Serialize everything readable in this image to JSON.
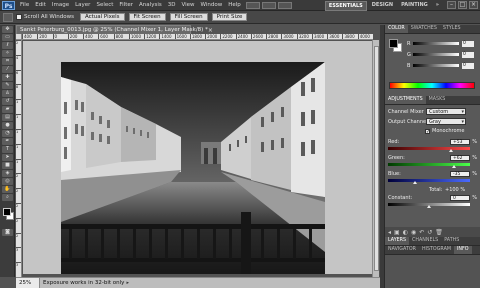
{
  "menubar": {
    "logo": "Ps",
    "items": [
      "File",
      "Edit",
      "Image",
      "Layer",
      "Select",
      "Filter",
      "Analysis",
      "3D",
      "View",
      "Window",
      "Help"
    ],
    "workspaces": [
      "ESSENTIALS",
      "DESIGN",
      "PAINTING",
      "»"
    ],
    "active_workspace": "ESSENTIALS",
    "controls": [
      "–",
      "□",
      "×"
    ]
  },
  "options": {
    "scroll_all_label": "Scroll All Windows",
    "buttons": [
      "Actual Pixels",
      "Fit Screen",
      "Fill Screen",
      "Print Size"
    ]
  },
  "document": {
    "tab_title": "Sankt Peterburg_0013.jpg @ 25% (Channel Mixer 1, Layer Mask/8) *",
    "ruler_h": [
      "400",
      "200",
      "0",
      "200",
      "400",
      "600",
      "800",
      "1000",
      "1200",
      "1400",
      "1600",
      "1800",
      "2000",
      "2200",
      "2400",
      "2600",
      "2800",
      "3000",
      "3200",
      "3400",
      "3600",
      "3800",
      "4000"
    ],
    "ruler_v": [
      "2",
      "4",
      "6",
      "8",
      "1",
      "1",
      "1",
      "1",
      "1",
      "2",
      "2",
      "2",
      "2",
      "2",
      "3",
      "3"
    ]
  },
  "status": {
    "zoom": "25%",
    "message": "Exposure works in 32-bit only"
  },
  "color_panel": {
    "tabs": [
      "COLOR",
      "SWATCHES",
      "STYLES"
    ],
    "channels": [
      {
        "label": "R",
        "value": "0"
      },
      {
        "label": "G",
        "value": "0"
      },
      {
        "label": "B",
        "value": "0"
      }
    ]
  },
  "adjustments_panel": {
    "tabs": [
      "ADJUSTMENTS",
      "MASKS"
    ],
    "title": "Channel Mixer",
    "preset_value": "Custom",
    "output_label": "Output Channel:",
    "output_value": "Gray",
    "monochrome_label": "Monochrome",
    "monochrome_checked": true,
    "channels": [
      {
        "name": "Red:",
        "value": "+53",
        "pct": "%",
        "level": 0.765
      },
      {
        "name": "Green:",
        "value": "+62",
        "pct": "%",
        "level": 0.81
      },
      {
        "name": "Blue:",
        "value": "-35",
        "pct": "%",
        "level": 0.325
      }
    ],
    "total_label": "Total:",
    "total_value": "+100 %",
    "constant_label": "Constant:",
    "constant_value": "0",
    "constant_pct": "%",
    "constant_level": 0.5
  },
  "layers_tabs": [
    "LAYERS",
    "CHANNELS",
    "PATHS"
  ],
  "nav_tabs": [
    "NAVIGATOR",
    "HISTOGRAM",
    "INFO"
  ],
  "colors": {
    "accent": "#1e4f8a",
    "panel": "#595959",
    "canvas": "#c5c5c5"
  }
}
